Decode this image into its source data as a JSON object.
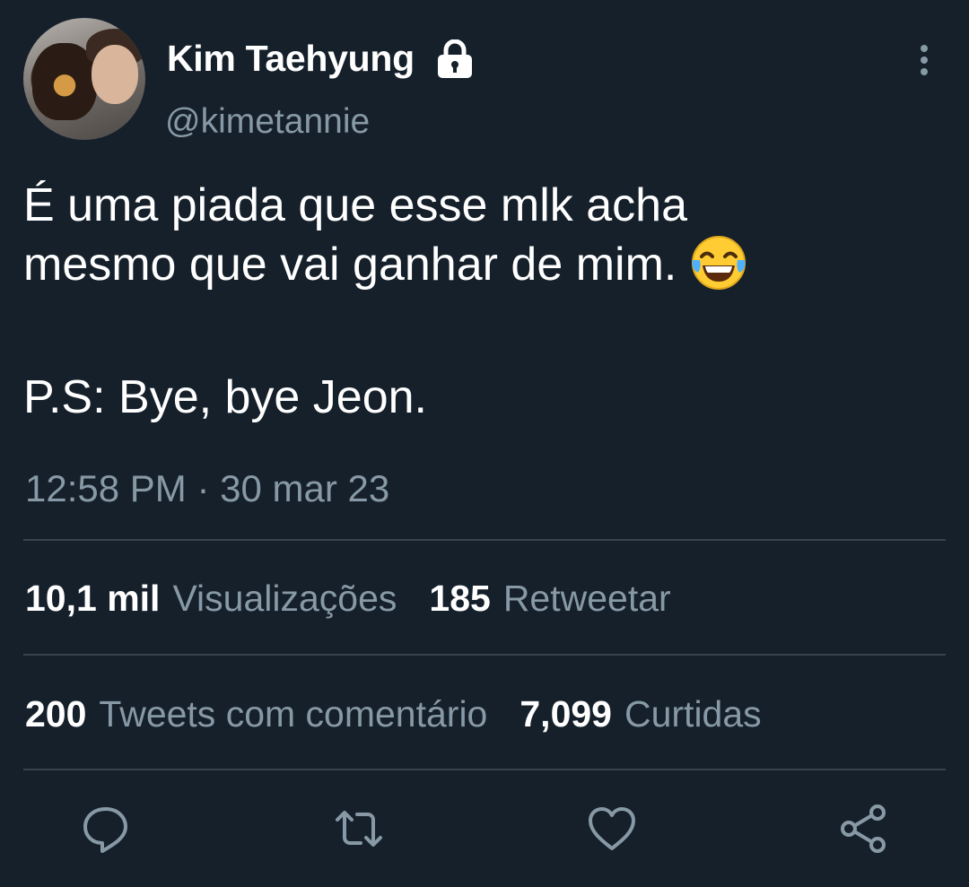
{
  "header": {
    "name": "Kim Taehyung",
    "handle": "@kimetannie"
  },
  "tweet": {
    "line1": "É uma piada que esse mlk acha",
    "line2": "mesmo que vai ganhar de mim.",
    "line3": "P.S: Bye, bye Jeon.",
    "emoji": "face-with-tears-of-joy",
    "timestamp": "12:58 PM · 30 mar 23"
  },
  "stats": {
    "views_count": "10,1 mil",
    "views_label": "Visualizações",
    "retweets_count": "185",
    "retweets_label": "Retweetar",
    "quotes_count": "200",
    "quotes_label": "Tweets com comentário",
    "likes_count": "7,099",
    "likes_label": "Curtidas"
  },
  "actions": [
    "reply-icon",
    "retweet-icon",
    "like-icon",
    "share-icon"
  ],
  "colors": {
    "background": "#15202b",
    "text": "#ffffff",
    "muted": "#8899a6",
    "divider": "#38444d"
  }
}
